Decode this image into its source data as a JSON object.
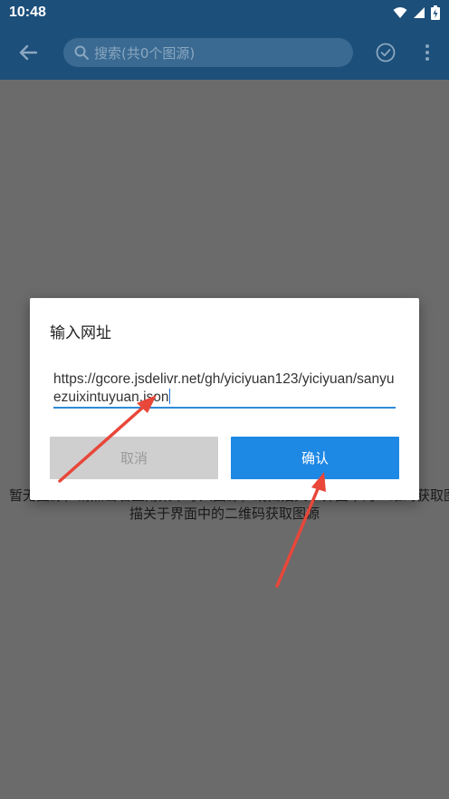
{
  "status_bar": {
    "time": "10:48",
    "icons": [
      "wifi-icon",
      "signal-icon",
      "battery-charging-icon"
    ]
  },
  "toolbar": {
    "back_icon": "arrow-left-icon",
    "search_placeholder": "搜索(共0个图源)",
    "search_icon": "search-icon",
    "confirm_icon": "check-circle-icon",
    "more_icon": "more-vertical-icon"
  },
  "main": {
    "empty_text_line1": "暂无图源，请点击右上角菜单导入图源，或扫描关于界面中的二维码获取图源",
    "empty_text_line2": "描关于界面中的二维码获取图源"
  },
  "dialog": {
    "title": "输入网址",
    "url_value": "https://gcore.jsdelivr.net/gh/yiciyuan123/yiciyuan/sanyuezuixintuyuan.json",
    "cancel_label": "取消",
    "confirm_label": "确认"
  },
  "colors": {
    "toolbar": "#1c4f7a",
    "overlay": "#6b6b6b",
    "accent": "#1e88e5",
    "arrow": "#e8473a"
  }
}
